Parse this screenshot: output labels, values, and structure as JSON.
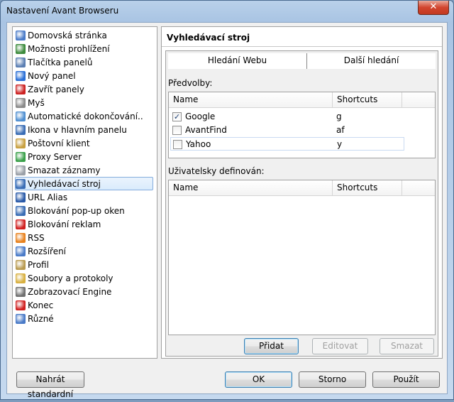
{
  "window": {
    "title": "Nastavení Avant Browseru",
    "close_glyph": "✕"
  },
  "nav": {
    "items": [
      {
        "label": "Domovská stránka",
        "icon": "home-icon",
        "color": "#4a7bc8"
      },
      {
        "label": "Možnosti prohlížení",
        "icon": "browse-options-icon",
        "color": "#3d8b3d"
      },
      {
        "label": "Tlačítka panelů",
        "icon": "toolbar-buttons-icon",
        "color": "#5b7fb3"
      },
      {
        "label": "Nový panel",
        "icon": "plus-icon",
        "color": "#2a6fd6"
      },
      {
        "label": "Zavřít panely",
        "icon": "close-panels-icon",
        "color": "#cc2222"
      },
      {
        "label": "Myš",
        "icon": "mouse-icon",
        "color": "#8a8a8a"
      },
      {
        "label": "Automatické dokončování..",
        "icon": "autocomplete-icon",
        "color": "#4f8fd1"
      },
      {
        "label": "Ikona v hlavním panelu",
        "icon": "taskbar-icon",
        "color": "#3a6db5"
      },
      {
        "label": "Poštovní klient",
        "icon": "mail-icon",
        "color": "#c8a040"
      },
      {
        "label": "Proxy Server",
        "icon": "proxy-icon",
        "color": "#3aa04a"
      },
      {
        "label": "Smazat záznamy",
        "icon": "clear-records-icon",
        "color": "#9aa0a8"
      },
      {
        "label": "Vyhledávací stroj",
        "icon": "search-engine-icon",
        "color": "#3a6db5"
      },
      {
        "label": "URL Alias",
        "icon": "url-alias-icon",
        "color": "#2a5aa8"
      },
      {
        "label": "Blokování pop-up oken",
        "icon": "popup-block-icon",
        "color": "#3a6db5"
      },
      {
        "label": "Blokování reklam",
        "icon": "ad-block-icon",
        "color": "#d02020"
      },
      {
        "label": "RSS",
        "icon": "rss-icon",
        "color": "#e8821e"
      },
      {
        "label": "Rozšíření",
        "icon": "extensions-icon",
        "color": "#4a7bc8"
      },
      {
        "label": "Profil",
        "icon": "profile-icon",
        "color": "#b89a50"
      },
      {
        "label": "Soubory a protokoly",
        "icon": "files-icon",
        "color": "#d8b040"
      },
      {
        "label": "Zobrazovací Engine",
        "icon": "engine-icon",
        "color": "#707070"
      },
      {
        "label": "Konec",
        "icon": "power-icon",
        "color": "#d02020"
      },
      {
        "label": "Různé",
        "icon": "misc-icon",
        "color": "#4a7bc8"
      }
    ],
    "selected_index": 11
  },
  "panel": {
    "title": "Vyhledávací stroj",
    "tabs": [
      {
        "label": "Hledání Webu",
        "active": true
      },
      {
        "label": "Další hledání",
        "active": false
      }
    ],
    "presets_label": "Předvolby:",
    "presets": {
      "columns": [
        "Name",
        "Shortcuts"
      ],
      "rows": [
        {
          "name": "Google",
          "shortcut": "g",
          "checked": true,
          "check_glyph": "✓"
        },
        {
          "name": "AvantFind",
          "shortcut": "af",
          "checked": false,
          "check_glyph": ""
        },
        {
          "name": "Yahoo",
          "shortcut": "y",
          "checked": false,
          "check_glyph": ""
        }
      ]
    },
    "user_label": "Uživatelsky definován:",
    "user_defined": {
      "columns": [
        "Name",
        "Shortcuts"
      ],
      "rows": []
    },
    "buttons": {
      "add": "Přidat",
      "edit": "Editovat",
      "delete": "Smazat"
    }
  },
  "footer": {
    "reset": "Nahrát standardní",
    "ok": "OK",
    "cancel": "Storno",
    "apply": "Použít"
  }
}
